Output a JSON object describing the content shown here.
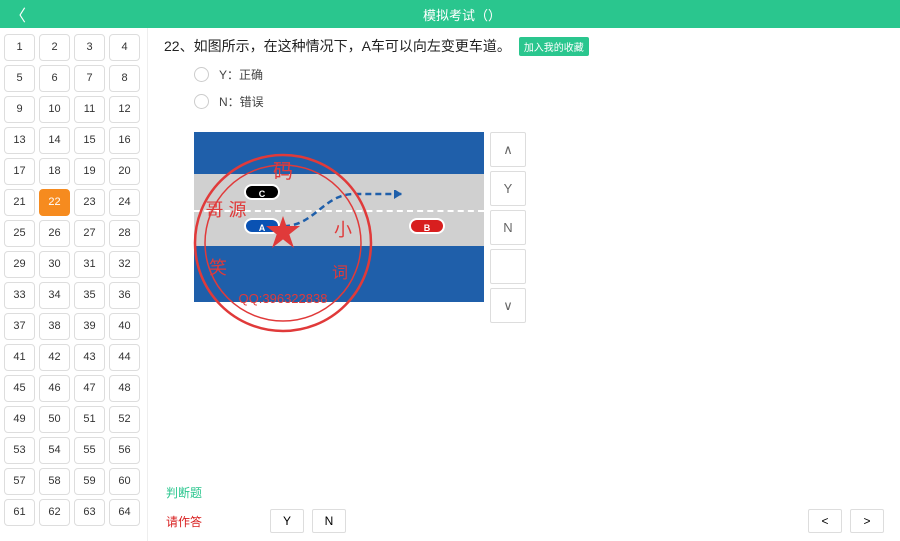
{
  "header": {
    "title": "模拟考试（）"
  },
  "question": {
    "number": "22、",
    "text": "如图所示，在这种情况下，A车可以向左变更车道。",
    "add_fav": "加入我的收藏"
  },
  "options": {
    "y": "Y：正确",
    "n": "N：错误"
  },
  "cars": {
    "a": "A",
    "b": "B",
    "c": "C"
  },
  "controls": {
    "up": "∧",
    "y": "Y",
    "n": "N",
    "blank": "",
    "down": "∨"
  },
  "judge_label": "判断题",
  "bottom": {
    "label": "请作答",
    "y": "Y",
    "n": "N",
    "prev": "<",
    "next": ">"
  },
  "grid": {
    "count": 64,
    "active": 22
  },
  "watermark": {
    "top": "码",
    "left": "哥 源",
    "right": "小",
    "bottom": "笑",
    "sub": "词",
    "qq": "QQ:396322838"
  }
}
